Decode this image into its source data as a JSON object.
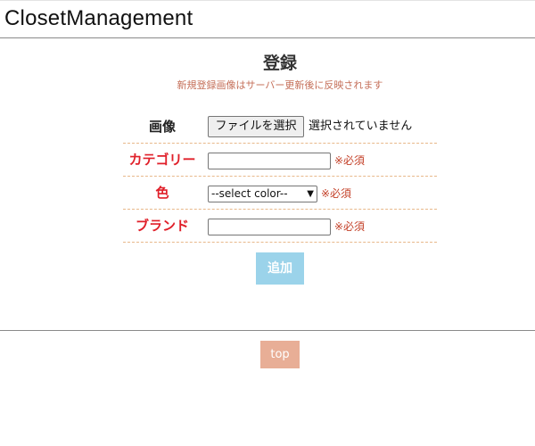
{
  "header": {
    "title": "ClosetManagement"
  },
  "page": {
    "title": "登録",
    "notice": "新規登録画像はサーバー更新後に反映されます"
  },
  "form": {
    "image": {
      "label": "画像",
      "button_label": "ファイルを選択",
      "status": "選択されていません"
    },
    "category": {
      "label": "カテゴリー",
      "value": "",
      "required": "※必須"
    },
    "color": {
      "label": "色",
      "selected": "--select color--",
      "required": "※必須"
    },
    "brand": {
      "label": "ブランド",
      "value": "",
      "required": "※必須"
    },
    "submit_label": "追加"
  },
  "footer": {
    "top_label": "top"
  },
  "colors": {
    "required_label": "#e0202a",
    "submit_button": "#9bd3ea",
    "top_button": "#e8ae96",
    "row_divider": "#e8b88a"
  },
  "icons": {
    "select_arrow": "chevron-down-icon"
  }
}
